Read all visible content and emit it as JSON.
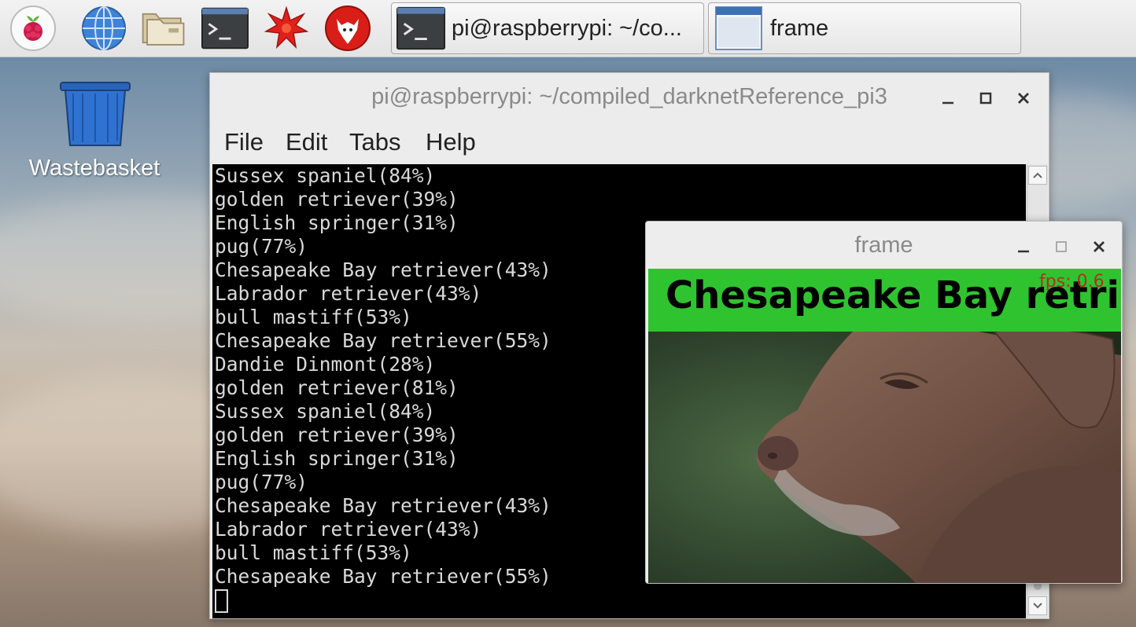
{
  "panel": {
    "launchers": [
      "raspberry-menu-icon",
      "web-browser-icon",
      "file-manager-icon",
      "terminal-icon",
      "mathematica-icon",
      "wolfram-icon"
    ],
    "tasks": [
      {
        "label": "pi@raspberrypi: ~/co...",
        "icon": "terminal-icon"
      },
      {
        "label": "frame",
        "icon": "window-icon"
      }
    ]
  },
  "desktop": {
    "wastebasket_label": "Wastebasket"
  },
  "terminal": {
    "title": "pi@raspberrypi: ~/compiled_darknetReference_pi3",
    "menu": [
      "File",
      "Edit",
      "Tabs",
      "Help"
    ],
    "lines": [
      "Sussex spaniel(84%)",
      "golden retriever(39%)",
      "English springer(31%)",
      "pug(77%)",
      "Chesapeake Bay retriever(43%)",
      "Labrador retriever(43%)",
      "bull mastiff(53%)",
      "Chesapeake Bay retriever(55%)",
      "Dandie Dinmont(28%)",
      "golden retriever(81%)",
      "Sussex spaniel(84%)",
      "golden retriever(39%)",
      "English springer(31%)",
      "pug(77%)",
      "Chesapeake Bay retriever(43%)",
      "Labrador retriever(43%)",
      "bull mastiff(53%)",
      "Chesapeake Bay retriever(55%)"
    ]
  },
  "frame_window": {
    "title": "frame",
    "label_text": "Chesapeake Bay retriever",
    "fps_text": "fps: 0.6",
    "label_color": "#2fc42f"
  },
  "colors": {
    "terminal_bg": "#000000",
    "terminal_fg": "#d9d9d9",
    "panel_bg": "#ececec"
  }
}
